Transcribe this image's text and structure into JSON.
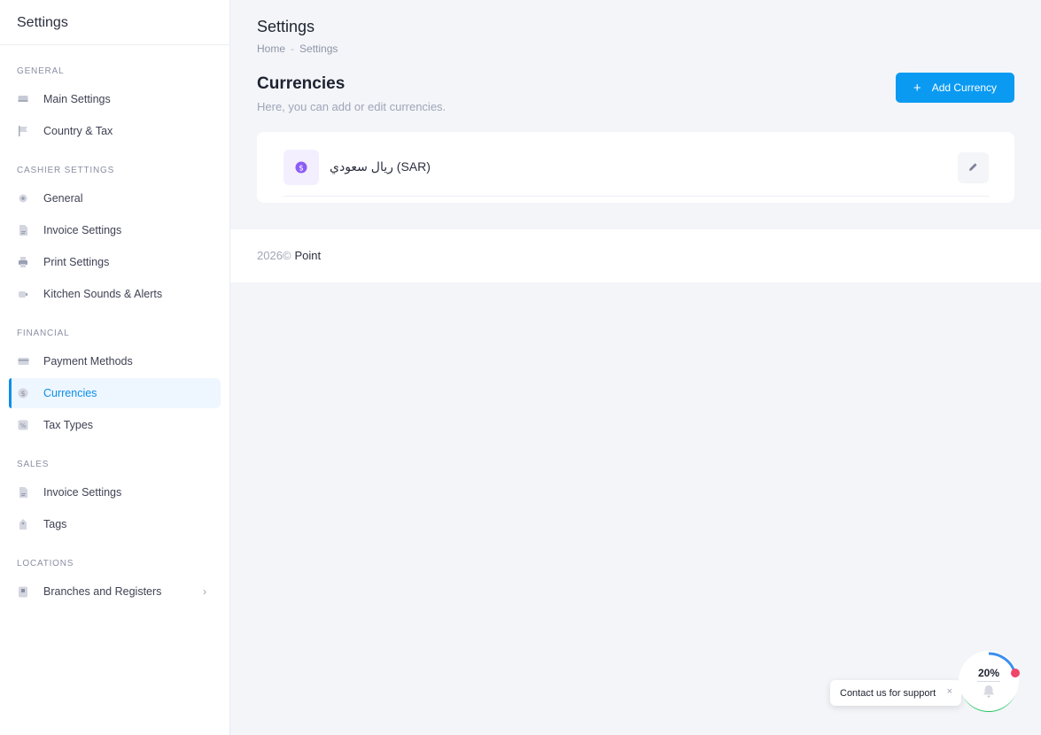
{
  "sidebar": {
    "title": "Settings",
    "sections": [
      {
        "title": "GENERAL",
        "items": [
          {
            "label": "Main Settings",
            "icon": "monitor-icon"
          },
          {
            "label": "Country & Tax",
            "icon": "flag-icon"
          }
        ]
      },
      {
        "title": "CASHIER SETTINGS",
        "items": [
          {
            "label": "General",
            "icon": "gear-icon"
          },
          {
            "label": "Invoice Settings",
            "icon": "document-icon"
          },
          {
            "label": "Print Settings",
            "icon": "printer-icon"
          },
          {
            "label": "Kitchen Sounds & Alerts",
            "icon": "speaker-icon"
          }
        ]
      },
      {
        "title": "FINANCIAL",
        "items": [
          {
            "label": "Payment Methods",
            "icon": "credit-card-icon"
          },
          {
            "label": "Currencies",
            "icon": "dollar-icon",
            "active": true
          },
          {
            "label": "Tax Types",
            "icon": "percent-icon"
          }
        ]
      },
      {
        "title": "SALES",
        "items": [
          {
            "label": "Invoice Settings",
            "icon": "document-icon"
          },
          {
            "label": "Tags",
            "icon": "tag-icon"
          }
        ]
      },
      {
        "title": "LOCATIONS",
        "items": [
          {
            "label": "Branches and Registers",
            "icon": "building-icon",
            "chevron": "›"
          }
        ]
      }
    ]
  },
  "header": {
    "title": "Settings",
    "breadcrumb": [
      "Home",
      "Settings"
    ],
    "breadcrumb_sep": "-"
  },
  "page": {
    "title": "Currencies",
    "subtitle": "Here, you can add or edit currencies.",
    "add_button": "Add Currency",
    "add_icon": "+"
  },
  "currencies": [
    {
      "name": "ريال سعودي (SAR)",
      "icon": "dollar-icon"
    }
  ],
  "footer": {
    "year": "2026©",
    "brand": "Point"
  },
  "support": {
    "label": "Contact us for support",
    "close": "×",
    "progress_text": "20%",
    "progress_value": 0.2
  },
  "colors": {
    "accent": "#0a9af2",
    "active_bg": "#eef6ff",
    "currency_icon": "#8b5cf6",
    "progress_blue": "#3b8ff0",
    "progress_green": "#22c55e",
    "notify_dot": "#f0446a"
  }
}
